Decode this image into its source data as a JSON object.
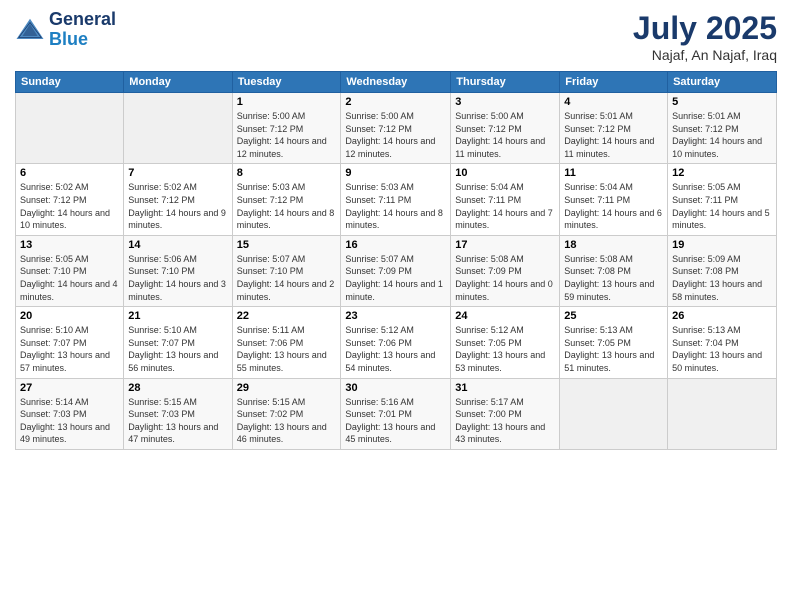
{
  "logo": {
    "line1": "General",
    "line2": "Blue"
  },
  "header": {
    "title": "July 2025",
    "subtitle": "Najaf, An Najaf, Iraq"
  },
  "weekdays": [
    "Sunday",
    "Monday",
    "Tuesday",
    "Wednesday",
    "Thursday",
    "Friday",
    "Saturday"
  ],
  "weeks": [
    [
      {
        "day": null
      },
      {
        "day": null
      },
      {
        "day": "1",
        "sunrise": "5:00 AM",
        "sunset": "7:12 PM",
        "daylight": "14 hours and 12 minutes."
      },
      {
        "day": "2",
        "sunrise": "5:00 AM",
        "sunset": "7:12 PM",
        "daylight": "14 hours and 12 minutes."
      },
      {
        "day": "3",
        "sunrise": "5:00 AM",
        "sunset": "7:12 PM",
        "daylight": "14 hours and 11 minutes."
      },
      {
        "day": "4",
        "sunrise": "5:01 AM",
        "sunset": "7:12 PM",
        "daylight": "14 hours and 11 minutes."
      },
      {
        "day": "5",
        "sunrise": "5:01 AM",
        "sunset": "7:12 PM",
        "daylight": "14 hours and 10 minutes."
      }
    ],
    [
      {
        "day": "6",
        "sunrise": "5:02 AM",
        "sunset": "7:12 PM",
        "daylight": "14 hours and 10 minutes."
      },
      {
        "day": "7",
        "sunrise": "5:02 AM",
        "sunset": "7:12 PM",
        "daylight": "14 hours and 9 minutes."
      },
      {
        "day": "8",
        "sunrise": "5:03 AM",
        "sunset": "7:12 PM",
        "daylight": "14 hours and 8 minutes."
      },
      {
        "day": "9",
        "sunrise": "5:03 AM",
        "sunset": "7:11 PM",
        "daylight": "14 hours and 8 minutes."
      },
      {
        "day": "10",
        "sunrise": "5:04 AM",
        "sunset": "7:11 PM",
        "daylight": "14 hours and 7 minutes."
      },
      {
        "day": "11",
        "sunrise": "5:04 AM",
        "sunset": "7:11 PM",
        "daylight": "14 hours and 6 minutes."
      },
      {
        "day": "12",
        "sunrise": "5:05 AM",
        "sunset": "7:11 PM",
        "daylight": "14 hours and 5 minutes."
      }
    ],
    [
      {
        "day": "13",
        "sunrise": "5:05 AM",
        "sunset": "7:10 PM",
        "daylight": "14 hours and 4 minutes."
      },
      {
        "day": "14",
        "sunrise": "5:06 AM",
        "sunset": "7:10 PM",
        "daylight": "14 hours and 3 minutes."
      },
      {
        "day": "15",
        "sunrise": "5:07 AM",
        "sunset": "7:10 PM",
        "daylight": "14 hours and 2 minutes."
      },
      {
        "day": "16",
        "sunrise": "5:07 AM",
        "sunset": "7:09 PM",
        "daylight": "14 hours and 1 minute."
      },
      {
        "day": "17",
        "sunrise": "5:08 AM",
        "sunset": "7:09 PM",
        "daylight": "14 hours and 0 minutes."
      },
      {
        "day": "18",
        "sunrise": "5:08 AM",
        "sunset": "7:08 PM",
        "daylight": "13 hours and 59 minutes."
      },
      {
        "day": "19",
        "sunrise": "5:09 AM",
        "sunset": "7:08 PM",
        "daylight": "13 hours and 58 minutes."
      }
    ],
    [
      {
        "day": "20",
        "sunrise": "5:10 AM",
        "sunset": "7:07 PM",
        "daylight": "13 hours and 57 minutes."
      },
      {
        "day": "21",
        "sunrise": "5:10 AM",
        "sunset": "7:07 PM",
        "daylight": "13 hours and 56 minutes."
      },
      {
        "day": "22",
        "sunrise": "5:11 AM",
        "sunset": "7:06 PM",
        "daylight": "13 hours and 55 minutes."
      },
      {
        "day": "23",
        "sunrise": "5:12 AM",
        "sunset": "7:06 PM",
        "daylight": "13 hours and 54 minutes."
      },
      {
        "day": "24",
        "sunrise": "5:12 AM",
        "sunset": "7:05 PM",
        "daylight": "13 hours and 53 minutes."
      },
      {
        "day": "25",
        "sunrise": "5:13 AM",
        "sunset": "7:05 PM",
        "daylight": "13 hours and 51 minutes."
      },
      {
        "day": "26",
        "sunrise": "5:13 AM",
        "sunset": "7:04 PM",
        "daylight": "13 hours and 50 minutes."
      }
    ],
    [
      {
        "day": "27",
        "sunrise": "5:14 AM",
        "sunset": "7:03 PM",
        "daylight": "13 hours and 49 minutes."
      },
      {
        "day": "28",
        "sunrise": "5:15 AM",
        "sunset": "7:03 PM",
        "daylight": "13 hours and 47 minutes."
      },
      {
        "day": "29",
        "sunrise": "5:15 AM",
        "sunset": "7:02 PM",
        "daylight": "13 hours and 46 minutes."
      },
      {
        "day": "30",
        "sunrise": "5:16 AM",
        "sunset": "7:01 PM",
        "daylight": "13 hours and 45 minutes."
      },
      {
        "day": "31",
        "sunrise": "5:17 AM",
        "sunset": "7:00 PM",
        "daylight": "13 hours and 43 minutes."
      },
      {
        "day": null
      },
      {
        "day": null
      }
    ]
  ],
  "labels": {
    "sunrise": "Sunrise:",
    "sunset": "Sunset:",
    "daylight": "Daylight:"
  }
}
